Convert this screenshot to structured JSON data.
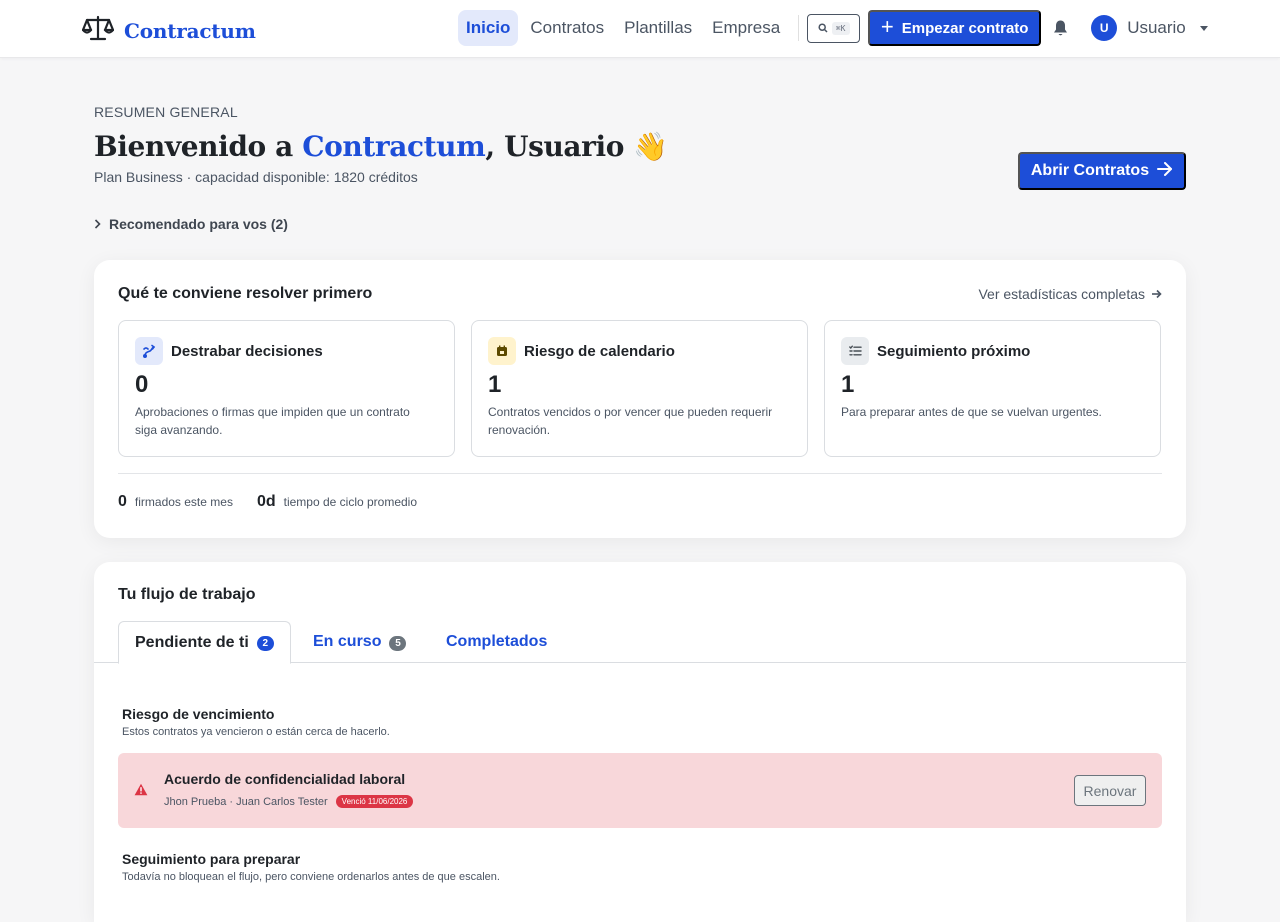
{
  "brand": {
    "name": "Contractum"
  },
  "nav": {
    "items": [
      {
        "label": "Inicio",
        "active": true
      },
      {
        "label": "Contratos",
        "active": false
      },
      {
        "label": "Plantillas",
        "active": false
      },
      {
        "label": "Empresa",
        "active": false
      }
    ],
    "search_shortcut": "⌘K",
    "start_contract_label": "Empezar contrato",
    "user": {
      "initial": "U",
      "name": "Usuario"
    }
  },
  "hero": {
    "overline": "RESUMEN GENERAL",
    "welcome_prefix": "Bienvenido a ",
    "welcome_brand": "Contractum",
    "welcome_suffix": ", Usuario 👋",
    "plan": "Plan Business · capacidad disponible: 1820 créditos",
    "open_contracts_label": "Abrir Contratos",
    "recommended": "Recomendado para vos (2)"
  },
  "priorities": {
    "title": "Qué te conviene resolver primero",
    "stats_link": "Ver estadísticas completas",
    "tiles": [
      {
        "title": "Destrabar decisiones",
        "value": "0",
        "desc": "Aprobaciones o firmas que impiden que un contrato siga avanzando.",
        "icon": "decision-icon",
        "icon_bg": "#e3e9fb",
        "icon_color": "#1d4ed8"
      },
      {
        "title": "Riesgo de calendario",
        "value": "1",
        "desc": "Contratos vencidos o por vencer que pueden requerir renovación.",
        "icon": "calendar-icon",
        "icon_bg": "#fff3cd",
        "icon_color": "#5c4a00"
      },
      {
        "title": "Seguimiento próximo",
        "value": "1",
        "desc": "Para preparar antes de que se vuelvan urgentes.",
        "icon": "checklist-icon",
        "icon_bg": "#e9ecef",
        "icon_color": "#495057"
      }
    ],
    "metrics": [
      {
        "value": "0",
        "label": "firmados este mes"
      },
      {
        "value": "0d",
        "label": "tiempo de ciclo promedio"
      }
    ]
  },
  "workflow": {
    "title": "Tu flujo de trabajo",
    "tabs": [
      {
        "label": "Pendiente de ti",
        "count": "2",
        "badge_color": "#1d4ed8"
      },
      {
        "label": "En curso",
        "count": "5",
        "badge_color": "#6c757d"
      },
      {
        "label": "Completados"
      }
    ],
    "expiry_section": {
      "title": "Riesgo de vencimiento",
      "subtitle": "Estos contratos ya vencieron o están cerca de hacerlo."
    },
    "expiry_row": {
      "title": "Acuerdo de confidencialidad laboral",
      "parties": "Jhon Prueba · Juan Carlos Tester",
      "badge": "Venció 11/06/2026",
      "action": "Renovar"
    },
    "followup_section": {
      "title": "Seguimiento para preparar",
      "subtitle": "Todavía no bloquean el flujo, pero conviene ordenarlos antes de que escalen."
    }
  }
}
